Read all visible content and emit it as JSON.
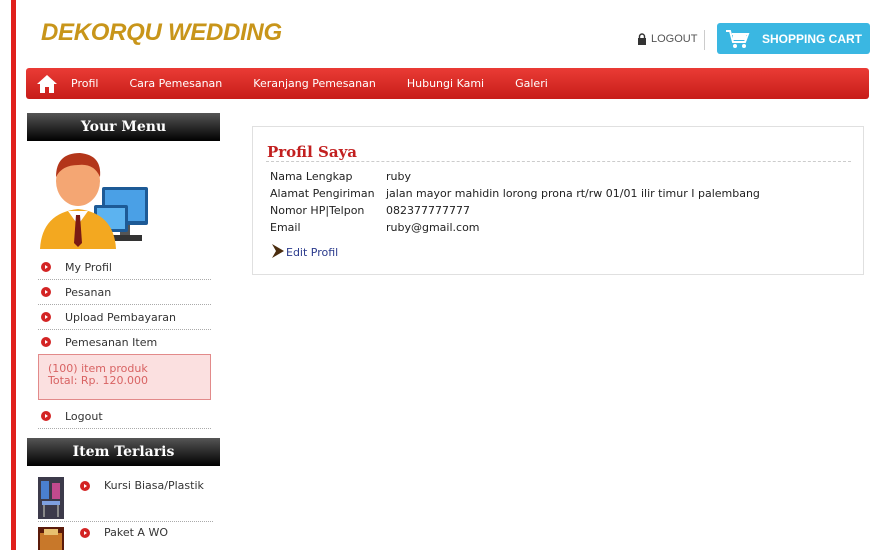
{
  "header": {
    "logo": "DEKORQU WEDDING",
    "logout_label": "LOGOUT",
    "cart_label": "SHOPPING CART",
    "accent_color": "#e0201c",
    "cart_color": "#3ab7e2"
  },
  "nav": {
    "items": [
      {
        "label": "Profil"
      },
      {
        "label": "Cara Pemesanan"
      },
      {
        "label": "Keranjang Pemesanan"
      },
      {
        "label": "Hubungi Kami"
      },
      {
        "label": "Galeri"
      }
    ]
  },
  "sidebar": {
    "menu_title": "Your Menu",
    "menu_items": [
      {
        "label": "My Profil"
      },
      {
        "label": "Pesanan"
      },
      {
        "label": "Upload Pembayaran"
      },
      {
        "label": "Pemesanan Item"
      }
    ],
    "cart_summary": {
      "items": "(100) item produk",
      "total": "Total: Rp. 120.000"
    },
    "logout_label": "Logout",
    "best_title": "Item Terlaris",
    "best_items": [
      {
        "name": "Kursi Biasa/Plastik"
      },
      {
        "name": "Paket A WO"
      }
    ]
  },
  "profile": {
    "title": "Profil Saya",
    "rows": [
      {
        "label": "Nama Lengkap",
        "value": "ruby"
      },
      {
        "label": "Alamat Pengiriman",
        "value": "jalan mayor mahidin lorong prona rt/rw 01/01 ilir timur I palembang"
      },
      {
        "label": "Nomor HP|Telpon",
        "value": "082377777777"
      },
      {
        "label": "Email",
        "value": "ruby@gmail.com"
      }
    ],
    "edit_label": "Edit Profil"
  }
}
